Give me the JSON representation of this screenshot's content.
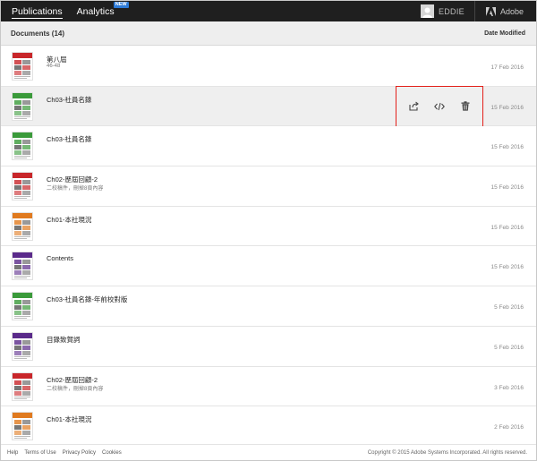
{
  "topbar": {
    "tabs": [
      {
        "label": "Publications",
        "active": true
      },
      {
        "label": "Analytics",
        "badge": "NEW",
        "active": false
      }
    ],
    "user_name": "EDDIE",
    "brand": "Adobe"
  },
  "list": {
    "title": "Documents (14)",
    "date_header": "Date Modified",
    "rows": [
      {
        "name": "第八屆",
        "sub": "46-48",
        "date": "17 Feb 2016",
        "thumb": "red"
      },
      {
        "name": "Ch03-社員名錄",
        "sub": "",
        "date": "15 Feb 2016",
        "thumb": "green",
        "hover": true
      },
      {
        "name": "Ch03-社員名錄",
        "sub": "",
        "date": "15 Feb 2016",
        "thumb": "green"
      },
      {
        "name": "Ch02-歷屆回顧-2",
        "sub": "二校稿件，刪掉8頁內容",
        "date": "15 Feb 2016",
        "thumb": "red"
      },
      {
        "name": "Ch01-本社現況",
        "sub": "",
        "date": "15 Feb 2016",
        "thumb": "orange"
      },
      {
        "name": "Contents",
        "sub": "",
        "date": "15 Feb 2016",
        "thumb": "purple"
      },
      {
        "name": "Ch03-社員名錄-年前校對版",
        "sub": "",
        "date": "5 Feb 2016",
        "thumb": "green"
      },
      {
        "name": "目錄致賀詞",
        "sub": "",
        "date": "5 Feb 2016",
        "thumb": "purple"
      },
      {
        "name": "Ch02-歷屆回顧-2",
        "sub": "二校稿件，刪掉8頁內容",
        "date": "3 Feb 2016",
        "thumb": "red"
      },
      {
        "name": "Ch01-本社現況",
        "sub": "",
        "date": "2 Feb 2016",
        "thumb": "orange"
      }
    ]
  },
  "row_actions": {
    "icons": [
      "share-icon",
      "embed-code-icon",
      "trash-icon"
    ]
  },
  "footer": {
    "links": [
      "Help",
      "Terms of Use",
      "Privacy Policy",
      "Cookies"
    ],
    "copyright": "Copyright © 2015 Adobe Systems Incorporated. All rights reserved."
  },
  "colors": {
    "topbar_bg": "#1f1f1f",
    "badge_blue": "#2d7bd8",
    "highlight_red": "#e3201a",
    "thumb_red": "#c8262a",
    "thumb_green": "#3a9a3a",
    "thumb_orange": "#e07a1f",
    "thumb_purple": "#5a2a8a"
  }
}
